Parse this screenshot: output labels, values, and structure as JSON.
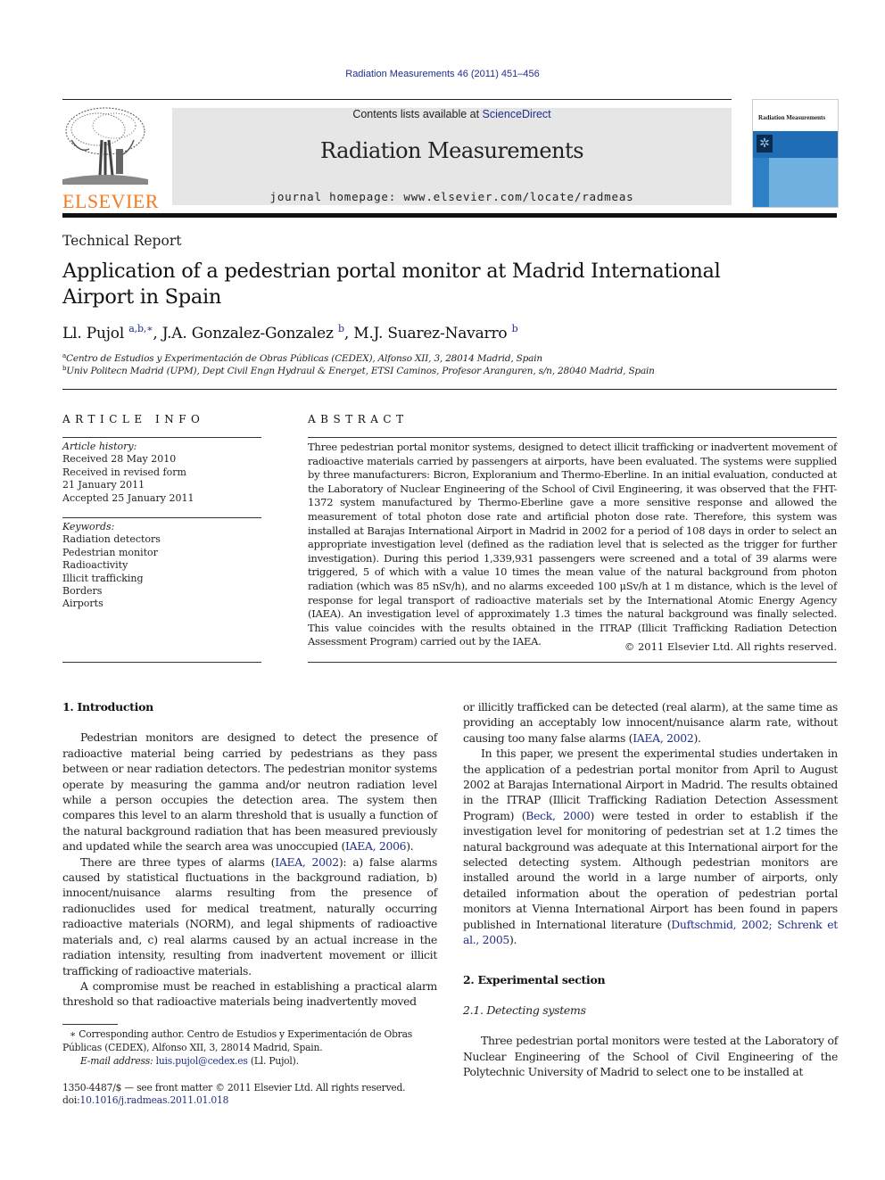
{
  "journal_ref": "Radiation Measurements 46 (2011) 451–456",
  "header": {
    "contents_prefix": "Contents lists available at ",
    "contents_link": "ScienceDirect",
    "journal_title": "Radiation Measurements",
    "homepage": "journal homepage: www.elsevier.com/locate/radmeas",
    "publisher": "ELSEVIER",
    "cover_title": "Radiation Measurements",
    "brand_color": "#f47b20",
    "link_color": "#1f2e8c"
  },
  "article": {
    "type": "Technical Report",
    "title_line1": "Application of a pedestrian portal monitor at Madrid International",
    "title_line2": "Airport in Spain",
    "authors": [
      {
        "name": "Ll. Pujol",
        "sup": "a,b,∗",
        "sep": ", "
      },
      {
        "name": "J.A. Gonzalez-Gonzalez",
        "sup": "b",
        "sep": ", "
      },
      {
        "name": "M.J. Suarez-Navarro",
        "sup": "b",
        "sep": ""
      }
    ],
    "affiliations": [
      {
        "mark": "a",
        "text": "Centro de Estudios y Experimentación de Obras Públicas (CEDEX), Alfonso XII, 3, 28014 Madrid, Spain"
      },
      {
        "mark": "b",
        "text": "Univ Politecn Madrid (UPM), Dept Civil Engn Hydraul & Energet, ETSI Caminos, Profesor Aranguren, s/n, 28040 Madrid, Spain"
      }
    ]
  },
  "article_info": {
    "heading": "ARTICLE INFO",
    "history_label": "Article history:",
    "history": [
      "Received 28 May 2010",
      "Received in revised form",
      "21 January 2011",
      "Accepted 25 January 2011"
    ],
    "keywords_label": "Keywords:",
    "keywords": [
      "Radiation detectors",
      "Pedestrian monitor",
      "Radioactivity",
      "Illicit trafficking",
      "Borders",
      "Airports"
    ]
  },
  "abstract": {
    "heading": "ABSTRACT",
    "text": "Three pedestrian portal monitor systems, designed to detect illicit trafficking or inadvertent movement of radioactive materials carried by passengers at airports, have been evaluated. The systems were supplied by three manufacturers: Bicron, Exploranium and Thermo-Eberline. In an initial evaluation, conducted at the Laboratory of Nuclear Engineering of the School of Civil Engineering, it was observed that the FHT-1372 system manufactured by Thermo-Eberline gave a more sensitive response and allowed the measurement of total photon dose rate and artificial photon dose rate. Therefore, this system was installed at Barajas International Airport in Madrid in 2002 for a period of 108 days in order to select an appropriate investigation level (defined as the radiation level that is selected as the trigger for further investigation). During this period 1,339,931 passengers were screened and a total of 39 alarms were triggered, 5 of which with a value 10 times the mean value of the natural background from photon radiation (which was 85 nSv/h), and no alarms exceeded 100 μSv/h at 1 m distance, which is the level of response for legal transport of radioactive materials set by the International Atomic Energy Agency (IAEA). An investigation level of approximately 1.3 times the natural background was finally selected. This value coincides with the results obtained in the ITRAP (Illicit Trafficking Radiation Detection Assessment Program) carried out by the IAEA.",
    "copyright": "© 2011 Elsevier Ltd. All rights reserved."
  },
  "body": {
    "sec1_heading": "1.  Introduction",
    "p1_text": "Pedestrian monitors are designed to detect the presence of radioactive material being carried by pedestrians as they pass between or near radiation detectors. The pedestrian monitor systems operate by measuring the gamma and/or neutron radiation level while a person occupies the detection area. The system then compares this level to an alarm threshold that is usually a function of the natural background radiation that has been measured previously and updated while the search area was unoccupied (",
    "p1_cite": "IAEA, 2006",
    "p1_end": ").",
    "p2_a": "There are three types of alarms (",
    "p2_cite": "IAEA, 2002",
    "p2_b": "): a) false alarms caused by statistical fluctuations in the background radiation, b) innocent/nuisance alarms resulting from the presence of radionuclides used for medical treatment, naturally occurring radioactive materials (NORM), and legal shipments of radioactive materials and, c) real alarms caused by an actual increase in the radiation intensity, resulting from inadvertent movement or illicit trafficking of radioactive materials.",
    "p3_text": "A compromise must be reached in establishing a practical alarm threshold so that radioactive materials being inadvertently moved",
    "p3_cont": "or illicitly trafficked can be detected (real alarm), at the same time as providing an acceptably low innocent/nuisance alarm rate, without causing too many false alarms (",
    "p3_cite": "IAEA, 2002",
    "p3_end": ").",
    "p4_a": "In this paper, we present the experimental studies undertaken in the application of a pedestrian portal monitor from April to August 2002 at Barajas International Airport in Madrid. The results obtained in the ITRAP (Illicit Trafficking Radiation Detection Assessment Program) (",
    "p4_cite": "Beck, 2000",
    "p4_b": ") were tested in order to establish if the investigation level for monitoring of pedestrian set at 1.2 times the natural background was adequate at this International airport for the selected detecting system. Although pedestrian monitors are installed around the world in a large number of airports, only detailed information about the operation of pedestrian portal monitors at Vienna International Airport has been found in papers published in International literature (",
    "p4_cite2": "Duftschmid, 2002; Schrenk et al., 2005",
    "p4_end": ").",
    "sec2_heading": "2.  Experimental section",
    "sec21_heading": "2.1.  Detecting systems",
    "p5_text": "Three pedestrian portal monitors were tested at the Laboratory of Nuclear Engineering of the School of Civil Engineering of the Polytechnic University of Madrid to select one to be installed at"
  },
  "footnotes": {
    "corresponding": "∗ Corresponding author. Centro de Estudios y Experimentación de Obras Públicas (CEDEX), Alfonso XII, 3, 28014 Madrid, Spain.",
    "email_label": "E-mail address:",
    "email": "luis.pujol@cedex.es",
    "email_suffix": " (Ll. Pujol).",
    "issn": "1350-4487/$ — see front matter © 2011 Elsevier Ltd. All rights reserved.",
    "doi_label": "doi:",
    "doi": "10.1016/j.radmeas.2011.01.018"
  }
}
